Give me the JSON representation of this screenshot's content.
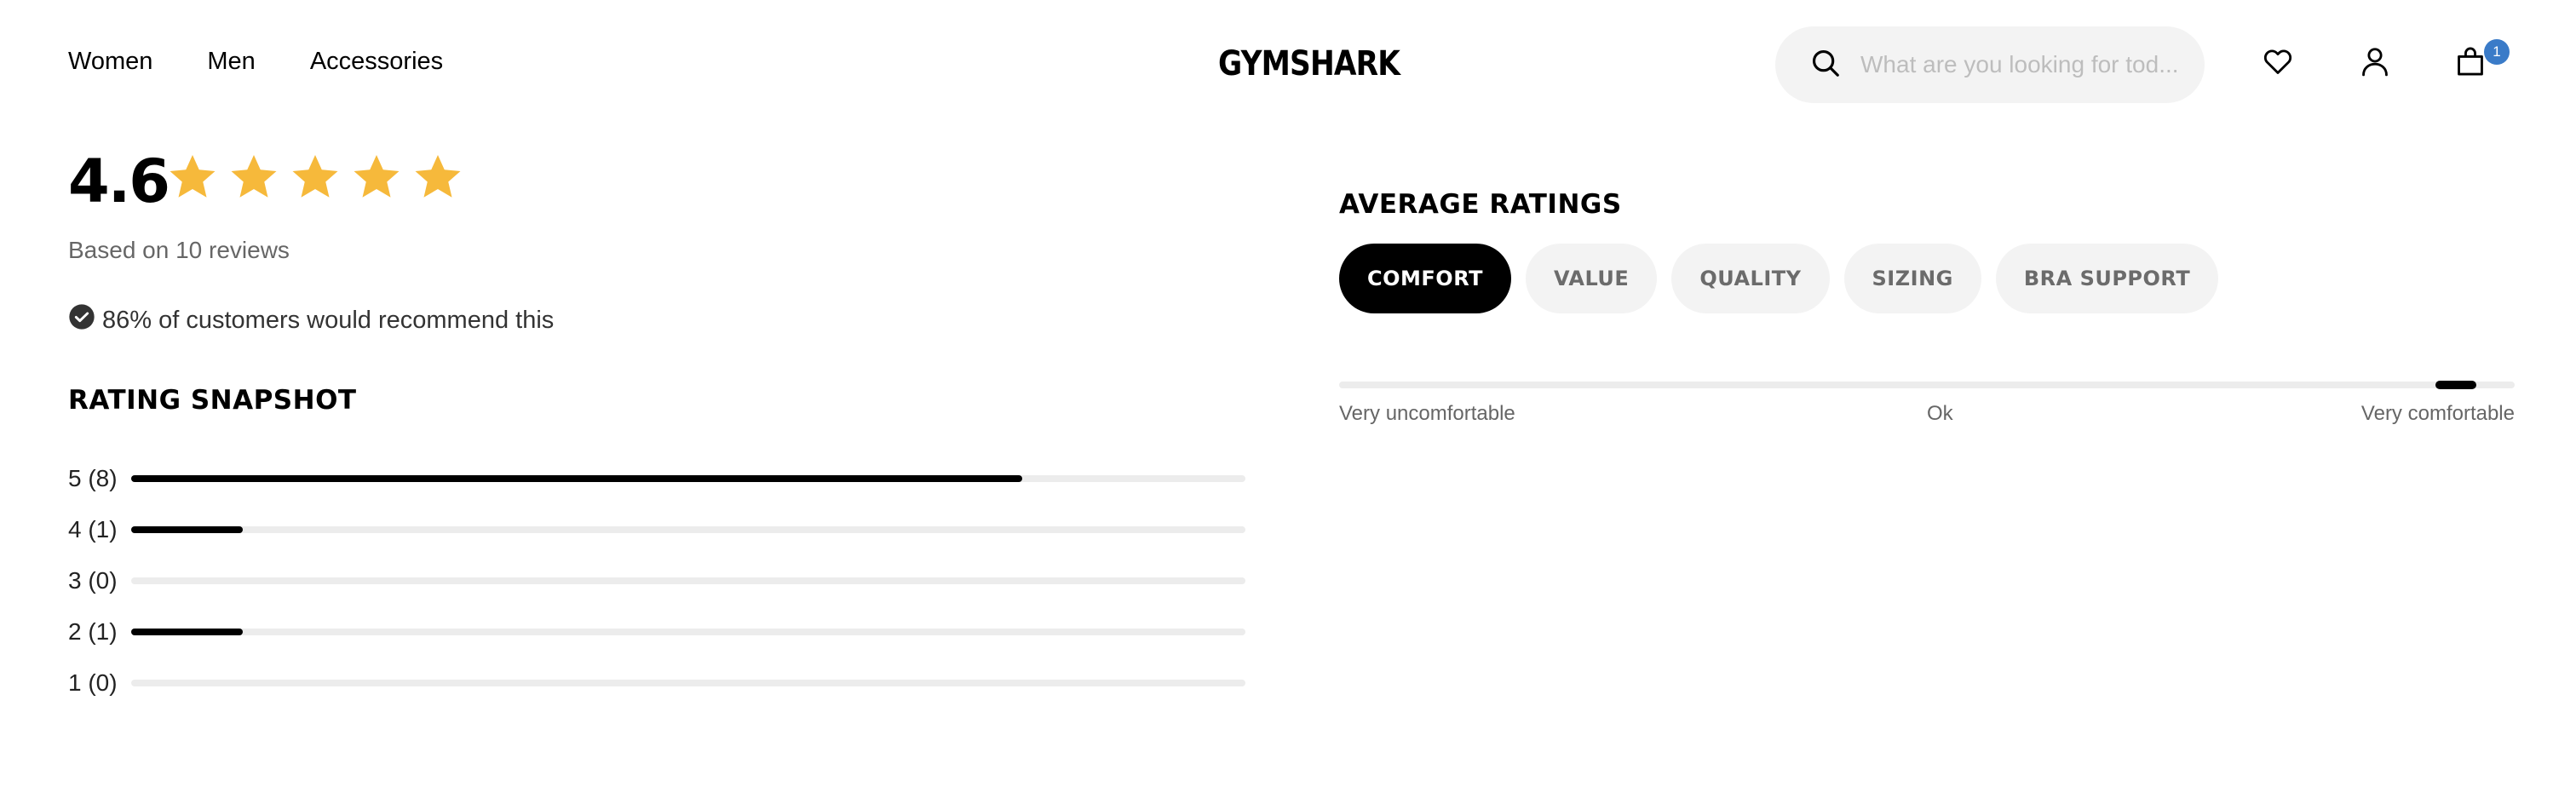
{
  "header": {
    "nav": [
      "Women",
      "Men",
      "Accessories"
    ],
    "logo": "GYMSHARK",
    "search_placeholder": "What are you looking for tod...",
    "cart_count": "1",
    "icons": [
      "search-icon",
      "heart-icon",
      "user-icon",
      "bag-icon"
    ]
  },
  "summary": {
    "score": "4.6",
    "star_rating": 4.6,
    "star_color": "#f6b93b",
    "based_on": "Based on 10 reviews",
    "recommend": "86% of customers would recommend this"
  },
  "snapshot": {
    "title": "RATING SNAPSHOT",
    "rows": [
      {
        "label": "5 (8)",
        "fraction": 0.8
      },
      {
        "label": "4 (1)",
        "fraction": 0.1
      },
      {
        "label": "3 (0)",
        "fraction": 0
      },
      {
        "label": "2 (1)",
        "fraction": 0.1
      },
      {
        "label": "1 (0)",
        "fraction": 0
      }
    ]
  },
  "average": {
    "title": "AVERAGE RATINGS",
    "tabs": [
      "COMFORT",
      "VALUE",
      "QUALITY",
      "SIZING",
      "BRA SUPPORT"
    ],
    "active_tab": 0,
    "scale": {
      "min_label": "Very uncomfortable",
      "mid_label": "Ok",
      "max_label": "Very comfortable",
      "position": 0.95
    }
  }
}
